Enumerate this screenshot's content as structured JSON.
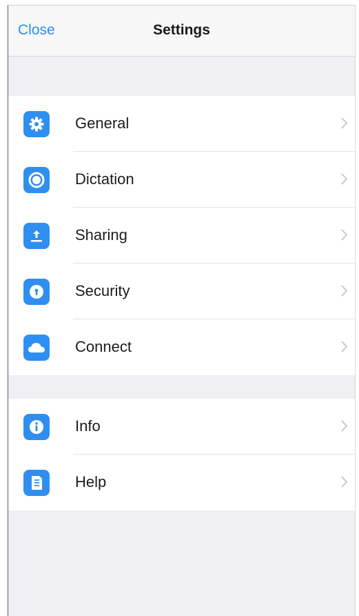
{
  "navbar": {
    "close_label": "Close",
    "title": "Settings"
  },
  "groups": [
    {
      "items": [
        {
          "label": "General",
          "icon": "gear-icon"
        },
        {
          "label": "Dictation",
          "icon": "microphone-circle-icon"
        },
        {
          "label": "Sharing",
          "icon": "upload-icon"
        },
        {
          "label": "Security",
          "icon": "lock-icon"
        },
        {
          "label": "Connect",
          "icon": "cloud-icon"
        }
      ]
    },
    {
      "items": [
        {
          "label": "Info",
          "icon": "info-icon"
        },
        {
          "label": "Help",
          "icon": "help-document-icon"
        }
      ]
    }
  ],
  "colors": {
    "accent": "#2f8ff0",
    "link": "#2b8ff0",
    "grouped_background": "#efeff4"
  }
}
